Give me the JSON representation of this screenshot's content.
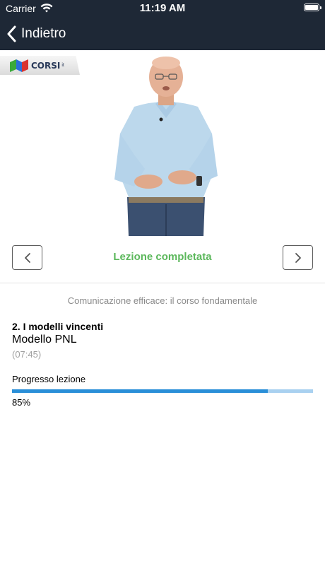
{
  "status_bar": {
    "carrier": "Carrier",
    "time": "11:19 AM"
  },
  "nav": {
    "back_label": "Indietro"
  },
  "video": {
    "logo_text": "CORSI",
    "logo_sup": "it",
    "colors": {
      "logo_blue": "#2a6fd8",
      "logo_green": "#3aaa3a",
      "logo_red": "#d9332f"
    }
  },
  "lesson_nav": {
    "status": "Lezione completata",
    "prev_icon": "chevron-left-icon",
    "next_icon": "chevron-right-icon"
  },
  "course": {
    "title": "Comunicazione efficace: il corso fondamentale",
    "module": "2. I modelli vincenti",
    "lesson": "Modello PNL",
    "duration": "(07:45)"
  },
  "progress": {
    "label": "Progresso lezione",
    "value_text": "85%",
    "fraction": 0.85
  },
  "colors": {
    "header_bg": "#1e2836",
    "success_green": "#5cb85c",
    "progress_fill": "#2a8fd8",
    "progress_track": "#a9d1f0"
  }
}
